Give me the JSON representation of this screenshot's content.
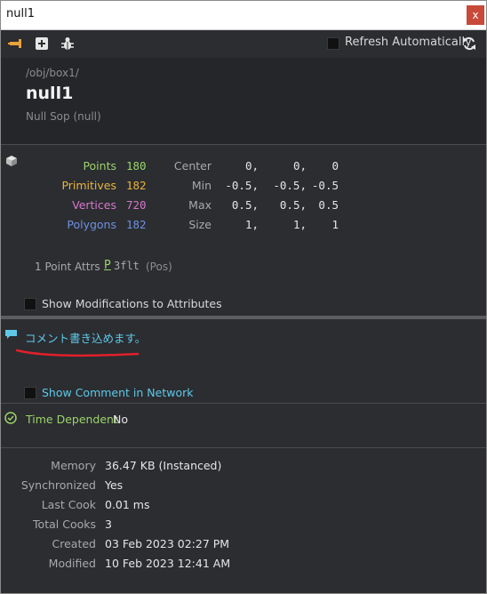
{
  "window": {
    "title": "null1",
    "close_label": "x"
  },
  "toolbar": {
    "refresh_label": "Refresh Automatically"
  },
  "node": {
    "path": "/obj/box1/",
    "name": "null1",
    "type": "Null Sop (null)"
  },
  "geometry": {
    "counts": [
      {
        "label": "Points",
        "value": "180",
        "color": "#9bd36a"
      },
      {
        "label": "Primitives",
        "value": "182",
        "color": "#e8b43a"
      },
      {
        "label": "Vertices",
        "value": "720",
        "color": "#d577c9"
      },
      {
        "label": "Polygons",
        "value": "182",
        "color": "#6f8fe0"
      }
    ],
    "bounds": [
      {
        "label": "Center",
        "x": "0,",
        "y": "0,",
        "z": "0"
      },
      {
        "label": "Min",
        "x": "-0.5,",
        "y": "-0.5,",
        "z": "-0.5"
      },
      {
        "label": "Max",
        "x": "0.5,",
        "y": "0.5,",
        "z": "0.5"
      },
      {
        "label": "Size",
        "x": "1,",
        "y": "1,",
        "z": "1"
      }
    ]
  },
  "attributes": {
    "label": "1 Point Attrs",
    "name": "P",
    "type": "3flt",
    "note": "(Pos)"
  },
  "show_modifications_label": "Show Modifications to Attributes",
  "comment": {
    "text": "コメント書き込めます。"
  },
  "show_comment_label": "Show Comment in Network",
  "time_dependent": {
    "label": "Time Dependent",
    "value": "No"
  },
  "info": [
    {
      "label": "Memory",
      "value": "36.47 KB (Instanced)"
    },
    {
      "label": "Synchronized",
      "value": "Yes"
    },
    {
      "label": "Last Cook",
      "value": "0.01 ms"
    },
    {
      "label": "Total Cooks",
      "value": "3"
    },
    {
      "label": "Created",
      "value": "03 Feb 2023 02:27 PM"
    },
    {
      "label": "Modified",
      "value": "10 Feb 2023 12:41 AM"
    }
  ],
  "colors": {
    "background": "#2b2d31",
    "header": "#24262a",
    "comment": "#5fc8e8",
    "accent_green": "#9bd36a",
    "annotation_red": "#e0202a"
  }
}
